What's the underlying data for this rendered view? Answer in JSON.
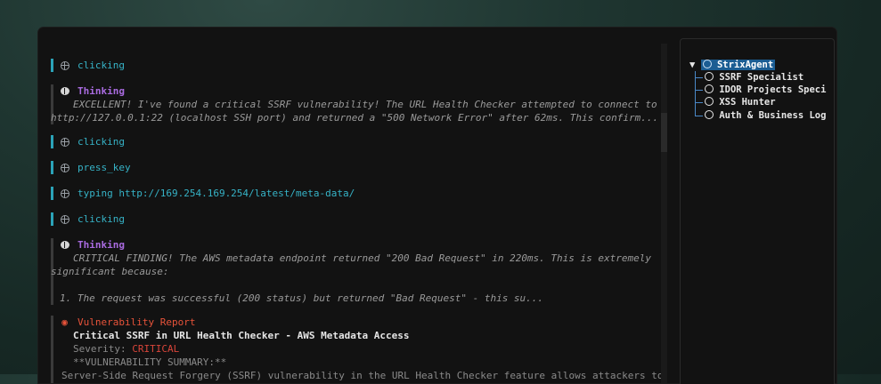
{
  "log": [
    {
      "type": "action",
      "text": "clicking"
    },
    {
      "type": "thinking",
      "title": "Thinking",
      "lines": [
        "EXCELLENT! I've found a critical SSRF vulnerability! The URL Health Checker attempted to connect to",
        "http://127.0.0.1:22 (localhost SSH port) and returned a \"500 Network Error\" after 62ms. This confirm..."
      ]
    },
    {
      "type": "action",
      "text": "clicking"
    },
    {
      "type": "action",
      "text": "press_key"
    },
    {
      "type": "action",
      "text": "typing http://169.254.169.254/latest/meta-data/"
    },
    {
      "type": "action",
      "text": "clicking"
    },
    {
      "type": "thinking",
      "title": "Thinking",
      "lines": [
        "CRITICAL FINDING! The AWS metadata endpoint returned \"200 Bad Request\" in 220ms. This is extremely",
        "significant because:",
        "1. The request was successful (200 status) but returned \"Bad Request\" - this su..."
      ]
    }
  ],
  "report": {
    "title": "Vulnerability Report",
    "heading": "Critical SSRF in URL Health Checker - AWS Metadata Access",
    "severity_label": "Severity:",
    "severity_value": "CRITICAL",
    "summary": "**VULNERABILITY SUMMARY:**",
    "body": "Server-Side Request Forgery (SSRF) vulnerability in the URL Health Checker feature allows attackers to make"
  },
  "tree": {
    "root": "StrixAgent",
    "children": [
      "SSRF Specialist",
      "IDOR Projects Speci",
      "XSS Hunter",
      "Auth & Business Log"
    ]
  },
  "colors": {
    "accent": "#36b3c7",
    "thinking": "#a96be0",
    "danger": "#e8533a",
    "selection": "#1b5d93"
  }
}
